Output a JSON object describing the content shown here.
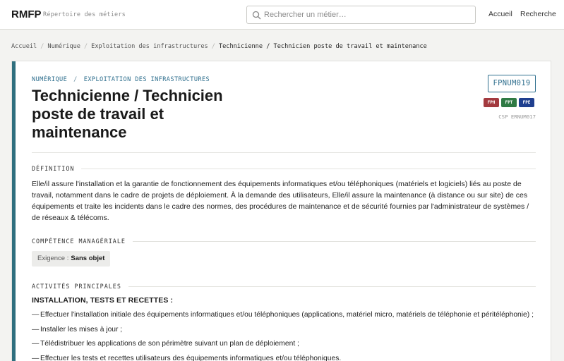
{
  "header": {
    "brand": "RMFP",
    "tagline": "Répertoire des métiers",
    "search_placeholder": "Rechercher un métier…",
    "nav": [
      "Accueil",
      "Recherche"
    ]
  },
  "breadcrumb": {
    "items": [
      "Accueil",
      "Numérique",
      "Exploitation des infrastructures"
    ],
    "current": "Technicienne / Technicien poste de travail et maintenance"
  },
  "job": {
    "domain": "NUMÉRIQUE",
    "family": "EXPLOITATION DES INFRASTRUCTURES",
    "title": "Technicienne / Technicien poste de travail et maintenance",
    "code": "FPNUM019",
    "fonctions_publiques": [
      {
        "label": "FPH",
        "color": "#a33a3f"
      },
      {
        "label": "FPT",
        "color": "#2f7a44"
      },
      {
        "label": "FPE",
        "color": "#1f3f8f"
      }
    ],
    "csp_code": "CSP ERNUM017"
  },
  "sections": {
    "definition_label": "DÉFINITION",
    "definition_text": "Elle/il assure l'installation et la garantie de fonctionnement des équipements informatiques et/ou téléphoniques (matériels et logiciels) liés au poste de travail, notamment dans le cadre de projets de déploiement. À la demande des utilisateurs, Elle/il assure la maintenance (à distance ou sur site) de ces équipements et traite les incidents dans le cadre des normes, des procédures de maintenance et de sécurité fournies par l'administrateur de systèmes / de réseaux & télécoms.",
    "competence_label": "COMPÉTENCE MANAGÉRIALE",
    "exigence_label": "Exigence :",
    "exigence_value": "Sans objet",
    "activities_label": "ACTIVITÉS PRINCIPALES",
    "activity_group_title": "INSTALLATION, TESTS ET RECETTES :",
    "activity_items": [
      "Effectuer l'installation initiale des équipements informatiques et/ou téléphoniques (applications, matériel micro, matériels de téléphonie et périté­léphonie) ;",
      "Installer les mises à jour ;",
      "Télédistribuer les applications de son périmètre suivant un plan de déploiement ;",
      "Effectuer les tests et recettes utilisateurs des équipements informatiques et/ou téléphoniques."
    ]
  },
  "colors": {
    "accent": "#2f6f8e",
    "card_bar": "#2f6f7e"
  }
}
